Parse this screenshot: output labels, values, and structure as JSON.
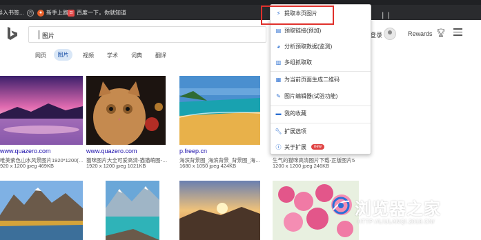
{
  "bookmarks": [
    {
      "label": "导入书签...",
      "icon": "import-icon"
    },
    {
      "label": "新手上路",
      "icon": "firefox-icon",
      "color": "#e8612c"
    },
    {
      "label": "百度一下，你就知道",
      "icon": "baidu-icon",
      "color": "#e24a4a"
    }
  ],
  "search": {
    "query": "图片"
  },
  "header": {
    "login": "登录",
    "rewards": "Rewards"
  },
  "tabs": [
    "网页",
    "图片",
    "视频",
    "学术",
    "词典",
    "翻译"
  ],
  "results_row1": [
    {
      "source": "www.quazero.com",
      "title": "唯美紫色山水风景图片1920*1200(…",
      "meta": "920 x 1200 jpeg 469KB"
    },
    {
      "source": "www.quazero.com",
      "title": "猫咪图片大全可爱高清-猫猫萌图-…",
      "meta": "1920 x 1200 jpeg 1021KB"
    },
    {
      "source": "p.freep.cn",
      "title": "海滨背景图_海滨背景_背景图_海…",
      "meta": "1680 x 1050 jpeg 424KB"
    },
    {
      "source": "",
      "title": "生气的猫咪高清图片下载-正版图片5",
      "meta": "1200 x 1200 jpeg 246KB"
    }
  ],
  "menu": {
    "items": [
      {
        "label": "提取本页图片",
        "icon": "lightning-icon"
      },
      {
        "label": "预取链接(预加)",
        "icon": "prefetch-icon"
      },
      {
        "label": "分析预取数据(监测)",
        "icon": "analyze-icon"
      },
      {
        "label": "多组抓取取",
        "icon": "grab-icon"
      },
      {
        "label": "为当前页面生成二维码",
        "icon": "qrcode-icon"
      },
      {
        "label": "图片编辑器(试验功能)",
        "icon": "edit-icon"
      },
      {
        "label": "我的收藏",
        "icon": "folder-icon"
      },
      {
        "label": "扩展选项",
        "icon": "wrench-icon"
      },
      {
        "label": "关于扩展",
        "icon": "info-icon"
      }
    ],
    "badge": "new"
  },
  "watermark": {
    "title": "浏览器之家",
    "url": "HTTP://LIULANQI.2018.CN/"
  },
  "colors": {
    "accent": "#174ea6",
    "highlight": "#e0302b",
    "chrome": "#2a2b2e"
  }
}
